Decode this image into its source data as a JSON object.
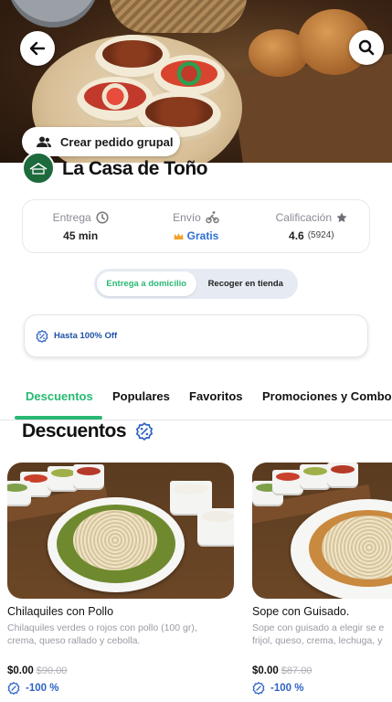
{
  "header": {
    "back_icon": "arrow-left-icon",
    "search_icon": "search-icon",
    "group_order_label": "Crear pedido grupal",
    "group_icon": "people-icon"
  },
  "restaurant": {
    "name": "La Casa de Toño",
    "logo_color": "#1d6a3d"
  },
  "info": {
    "delivery_label": "Entrega",
    "delivery_value": "45 min",
    "shipping_label": "Envío",
    "shipping_value": "Gratis",
    "rating_label": "Calificación",
    "rating_value": "4.6",
    "rating_count": "(5924)"
  },
  "mode_toggle": {
    "options": [
      "Entrega a domicilio",
      "Recoger en tienda"
    ],
    "selected": "Entrega a domicilio"
  },
  "promo": {
    "text": "Hasta 100% Off"
  },
  "tabs": [
    "Descuentos",
    "Populares",
    "Favoritos",
    "Promociones y Combos"
  ],
  "active_tab": "Descuentos",
  "section": {
    "title": "Descuentos"
  },
  "products": [
    {
      "name": "Chilaquiles con Pollo",
      "desc_line1": "Chilaquiles verdes o rojos con pollo (100 gr),",
      "desc_line2": "crema, queso rallado y cebolla.",
      "price": "$0.00",
      "original_price": "$90.00",
      "discount": "-100 %"
    },
    {
      "name": "Sope con Guisado.",
      "desc_line1": "Sope con guisado a elegir se e",
      "desc_line2": "frijol, queso, crema, lechuga, y",
      "price": "$0.00",
      "original_price": "$87.00",
      "discount": "-100 %"
    }
  ],
  "colors": {
    "accent_green": "#28b873",
    "accent_blue": "#2e63c4",
    "toggle_bg": "#e6eaf3"
  }
}
